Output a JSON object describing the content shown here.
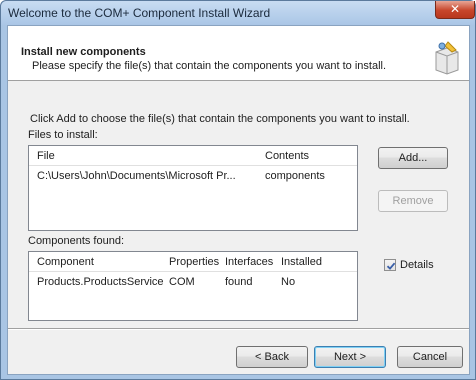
{
  "window": {
    "title": "Welcome to the COM+ Component Install Wizard"
  },
  "header": {
    "title": "Install new components",
    "subtitle": "Please specify the file(s) that contain the components you want to install."
  },
  "instruction": "Click Add to choose the file(s) that contain the components you want to install.",
  "files": {
    "label": "Files to install:",
    "columns": [
      "File",
      "Contents"
    ],
    "rows": [
      [
        "C:\\Users\\John\\Documents\\Microsoft Pr...",
        "components"
      ]
    ]
  },
  "components": {
    "label": "Components found:",
    "columns": [
      "Component",
      "Properties",
      "Interfaces",
      "Installed"
    ],
    "rows": [
      [
        "Products.ProductsService",
        "COM",
        "found",
        "No"
      ]
    ]
  },
  "buttons": {
    "add": "Add...",
    "remove": "Remove",
    "back": "< Back",
    "next": "Next >",
    "cancel": "Cancel"
  },
  "details": {
    "label": "Details",
    "checked": true
  },
  "icons": {
    "close": "close-icon",
    "header": "wizard-package-icon"
  },
  "colors": {
    "titlebar": "#aac6e6",
    "close": "#c7462b",
    "dialog_bg": "#f0f0f0"
  }
}
